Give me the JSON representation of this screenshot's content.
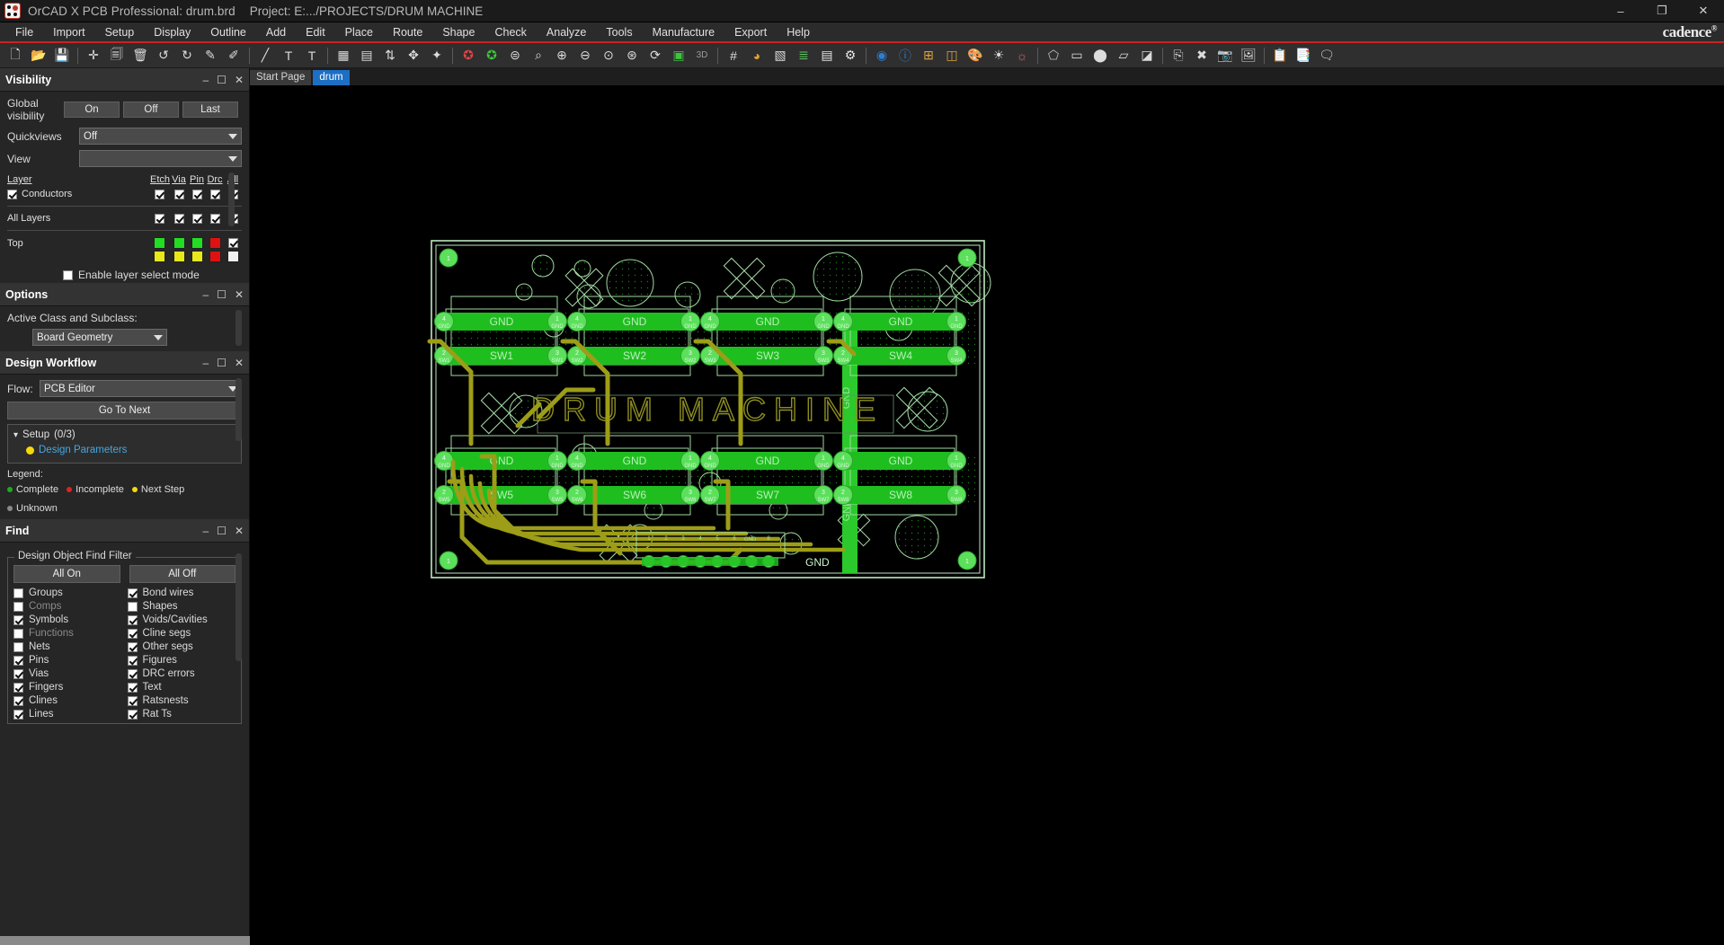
{
  "window": {
    "app_title": "OrCAD X PCB Professional: drum.brd",
    "project_label": "Project: E:.../PROJECTS/DRUM MACHINE",
    "minimize": "–",
    "maximize": "❐",
    "close": "✕",
    "brand": "cadence",
    "brand_mark": "®"
  },
  "menu": {
    "items": [
      "File",
      "Import",
      "Setup",
      "Display",
      "Outline",
      "Add",
      "Edit",
      "Place",
      "Route",
      "Shape",
      "Check",
      "Analyze",
      "Tools",
      "Manufacture",
      "Export",
      "Help"
    ]
  },
  "toolbar": {
    "groups": [
      [
        "new-file-icon",
        "open-folder-icon",
        "save-icon"
      ],
      [
        "move-icon",
        "copy-icon",
        "delete-icon",
        "undo-icon",
        "redo-icon",
        "pin-icon",
        "unpin-icon"
      ],
      [
        "add-line-icon",
        "add-text-icon",
        "edit-text-icon"
      ],
      [
        "place-component-icon",
        "quickplace-icon",
        "swap-icon",
        "placement-edit-icon",
        "autoplace-icon"
      ],
      [
        "ratsnest-red-icon",
        "ratsnest-green-icon",
        "zoom-fit-icon",
        "zoom-by-points-icon",
        "zoom-in-icon",
        "zoom-out-icon",
        "zoom-previous-icon",
        "zoom-center-icon",
        "refresh-icon",
        "board-3d-icon",
        "view-3d-icon"
      ],
      [
        "grid-toggle-icon",
        "color-palette-icon",
        "layer-visibility-icon",
        "stackup-icon",
        "reports-icon",
        "properties-icon"
      ],
      [
        "display-eye-icon",
        "element-info-icon",
        "measure-icon",
        "3d-cube-icon",
        "color-by-net-icon",
        "highlight-icon",
        "dehighlight-icon"
      ],
      [
        "add-shape-icon",
        "add-rect-icon",
        "add-circle-icon",
        "select-shape-icon",
        "shape-edit-icon"
      ],
      [
        "copy-shape-icon",
        "delete-shape-icon",
        "camera-icon",
        "snapshot-icon"
      ],
      [
        "drc-report-icon",
        "constraint-manager-icon",
        "notes-icon"
      ]
    ]
  },
  "tabs": [
    {
      "label": "Start Page",
      "active": false
    },
    {
      "label": "drum",
      "active": true
    }
  ],
  "visibility": {
    "title": "Visibility",
    "global_visibility_label": "Global visibility",
    "global_buttons": [
      "On",
      "Off",
      "Last"
    ],
    "quickviews_label": "Quickviews",
    "quickviews_value": "Off",
    "view_label": "View",
    "view_value": "",
    "columns": [
      "Layer",
      "Etch",
      "Via",
      "Pin",
      "Drc",
      "All"
    ],
    "rows": [
      {
        "name": "Conductors",
        "has_name_checkbox": true,
        "name_checked": true,
        "cells": [
          "check",
          "check",
          "check",
          "check",
          "check"
        ]
      },
      {
        "name": "All Layers",
        "has_name_checkbox": false,
        "cells": [
          "check",
          "check",
          "check",
          "check",
          "check"
        ]
      },
      {
        "name": "Top",
        "has_name_checkbox": false,
        "cells": [
          "swatch",
          "swatch",
          "swatch",
          "swatch",
          "check"
        ],
        "swatch_colors": [
          "#22dd22",
          "#22dd22",
          "#22dd22",
          "#e01111",
          ""
        ]
      },
      {
        "name": "",
        "has_name_checkbox": false,
        "cells": [
          "swatch",
          "swatch",
          "swatch",
          "swatch",
          "swatch"
        ],
        "swatch_colors": [
          "#e8e81a",
          "#e8e81a",
          "#e8e81a",
          "#e01111",
          "#f2f2f2"
        ]
      }
    ],
    "enable_layer_select_label": "Enable layer select mode",
    "enable_layer_select_checked": false
  },
  "options": {
    "title": "Options",
    "active_class_label": "Active Class and Subclass:",
    "active_class_value": "Board Geometry"
  },
  "workflow": {
    "title": "Design Workflow",
    "flow_label": "Flow:",
    "flow_value": "PCB Editor",
    "go_to_next_label": "Go To Next",
    "section_label": "Setup",
    "section_count": "(0/3)",
    "items": [
      {
        "label": "Design Parameters",
        "status_color": "#f5d90a"
      }
    ],
    "legend_label": "Legend:",
    "legend_items": [
      {
        "label": "Complete",
        "color": "#1faa1f"
      },
      {
        "label": "Incomplete",
        "color": "#e02222"
      },
      {
        "label": "Next Step",
        "color": "#f5d90a"
      },
      {
        "label": "Unknown",
        "color": "#8a8a8a"
      }
    ]
  },
  "find": {
    "title": "Find",
    "group_title": "Design Object Find Filter",
    "all_on_label": "All On",
    "all_off_label": "All Off",
    "filters": [
      {
        "label": "Groups",
        "checked": false,
        "dim": false
      },
      {
        "label": "Bond wires",
        "checked": true,
        "dim": false
      },
      {
        "label": "Comps",
        "checked": false,
        "dim": true
      },
      {
        "label": "Shapes",
        "checked": false,
        "dim": false
      },
      {
        "label": "Symbols",
        "checked": true,
        "dim": false
      },
      {
        "label": "Voids/Cavities",
        "checked": true,
        "dim": false
      },
      {
        "label": "Functions",
        "checked": false,
        "dim": true
      },
      {
        "label": "Cline segs",
        "checked": true,
        "dim": false
      },
      {
        "label": "Nets",
        "checked": false,
        "dim": false
      },
      {
        "label": "Other segs",
        "checked": true,
        "dim": false
      },
      {
        "label": "Pins",
        "checked": true,
        "dim": false
      },
      {
        "label": "Figures",
        "checked": true,
        "dim": false
      },
      {
        "label": "Vias",
        "checked": true,
        "dim": false
      },
      {
        "label": "DRC errors",
        "checked": true,
        "dim": false
      },
      {
        "label": "Fingers",
        "checked": true,
        "dim": false
      },
      {
        "label": "Text",
        "checked": true,
        "dim": false
      },
      {
        "label": "Clines",
        "checked": true,
        "dim": false
      },
      {
        "label": "Ratsnests",
        "checked": true,
        "dim": false
      },
      {
        "label": "Lines",
        "checked": true,
        "dim": false
      },
      {
        "label": "Rat Ts",
        "checked": true,
        "dim": false
      }
    ]
  },
  "board": {
    "silkscreen_title": "DRUM MACHINE",
    "net_gnd": "GND",
    "switch_labels": [
      "SW1",
      "SW2",
      "SW3",
      "SW4",
      "SW5",
      "SW6",
      "SW7",
      "SW8"
    ],
    "gnd_pad_labels": {
      "top": "4",
      "bottom": "1",
      "sw_left": "2",
      "sw_right": "3"
    },
    "corner_pad_label": "1",
    "header_net_label": "GND",
    "header_pin_labels": [
      "1",
      "2",
      "3",
      "4",
      "5",
      "6",
      "7",
      "8"
    ],
    "colors": {
      "copper_green": "#1db91d",
      "pad_green": "#55e055",
      "trace_olive": "#9d9d18",
      "outline_green": "#bfe8bf",
      "silk_olive": "#8d8d20",
      "background": "#000000"
    }
  }
}
